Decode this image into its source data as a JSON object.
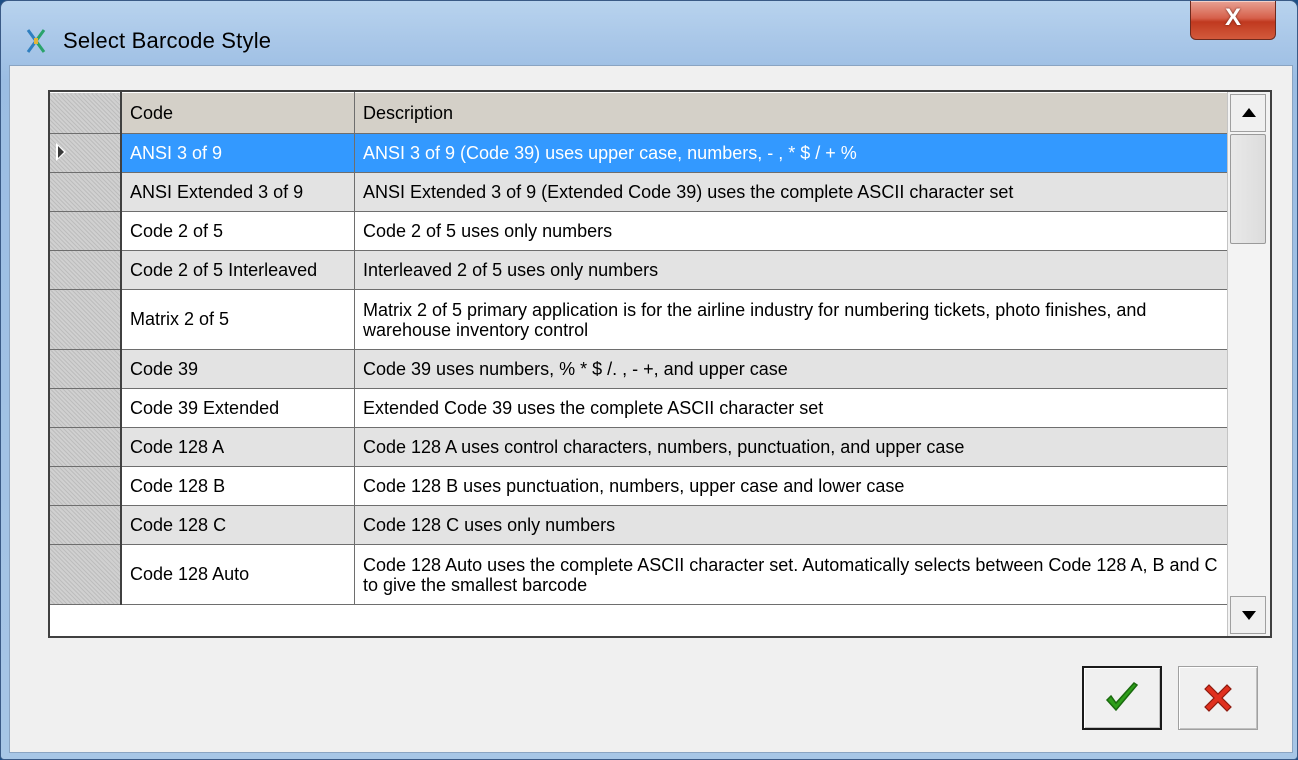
{
  "window": {
    "title": "Select Barcode Style",
    "close_label": "X"
  },
  "grid": {
    "columns": [
      "Code",
      "Description"
    ],
    "selected_index": 0,
    "rows": [
      {
        "code": "ANSI 3 of 9",
        "description": "ANSI 3 of 9 (Code 39) uses upper case, numbers, - , * $ / + %"
      },
      {
        "code": "ANSI Extended 3 of 9",
        "description": "ANSI Extended 3 of 9 (Extended Code 39) uses the complete ASCII character set"
      },
      {
        "code": "Code 2 of 5",
        "description": "Code 2 of 5 uses only numbers"
      },
      {
        "code": "Code 2 of 5 Interleaved",
        "description": "Interleaved 2 of 5 uses only numbers"
      },
      {
        "code": "Matrix 2 of 5",
        "description": "Matrix 2 of 5 primary application is for the airline industry for numbering tickets, photo finishes, and warehouse inventory control"
      },
      {
        "code": "Code 39",
        "description": "Code 39 uses numbers, % * $ /. , - +, and upper case"
      },
      {
        "code": "Code 39 Extended",
        "description": "Extended Code 39 uses the complete ASCII character set"
      },
      {
        "code": "Code 128 A",
        "description": "Code 128 A uses control characters, numbers, punctuation, and upper case"
      },
      {
        "code": "Code 128 B",
        "description": "Code 128 B uses punctuation, numbers, upper case and lower case"
      },
      {
        "code": "Code 128 C",
        "description": "Code 128 C uses only numbers"
      },
      {
        "code": "Code 128 Auto",
        "description": "Code 128 Auto uses the complete ASCII character set.  Automatically selects between Code 128 A, B and C to give the smallest barcode"
      }
    ]
  },
  "buttons": {
    "ok": {
      "icon": "green-checkmark-icon",
      "color": "#2e9e1a"
    },
    "cancel": {
      "icon": "red-x-icon",
      "color": "#e0301e"
    }
  },
  "colors": {
    "selection": "#3399ff",
    "alt_row": "#e3e3e3"
  }
}
